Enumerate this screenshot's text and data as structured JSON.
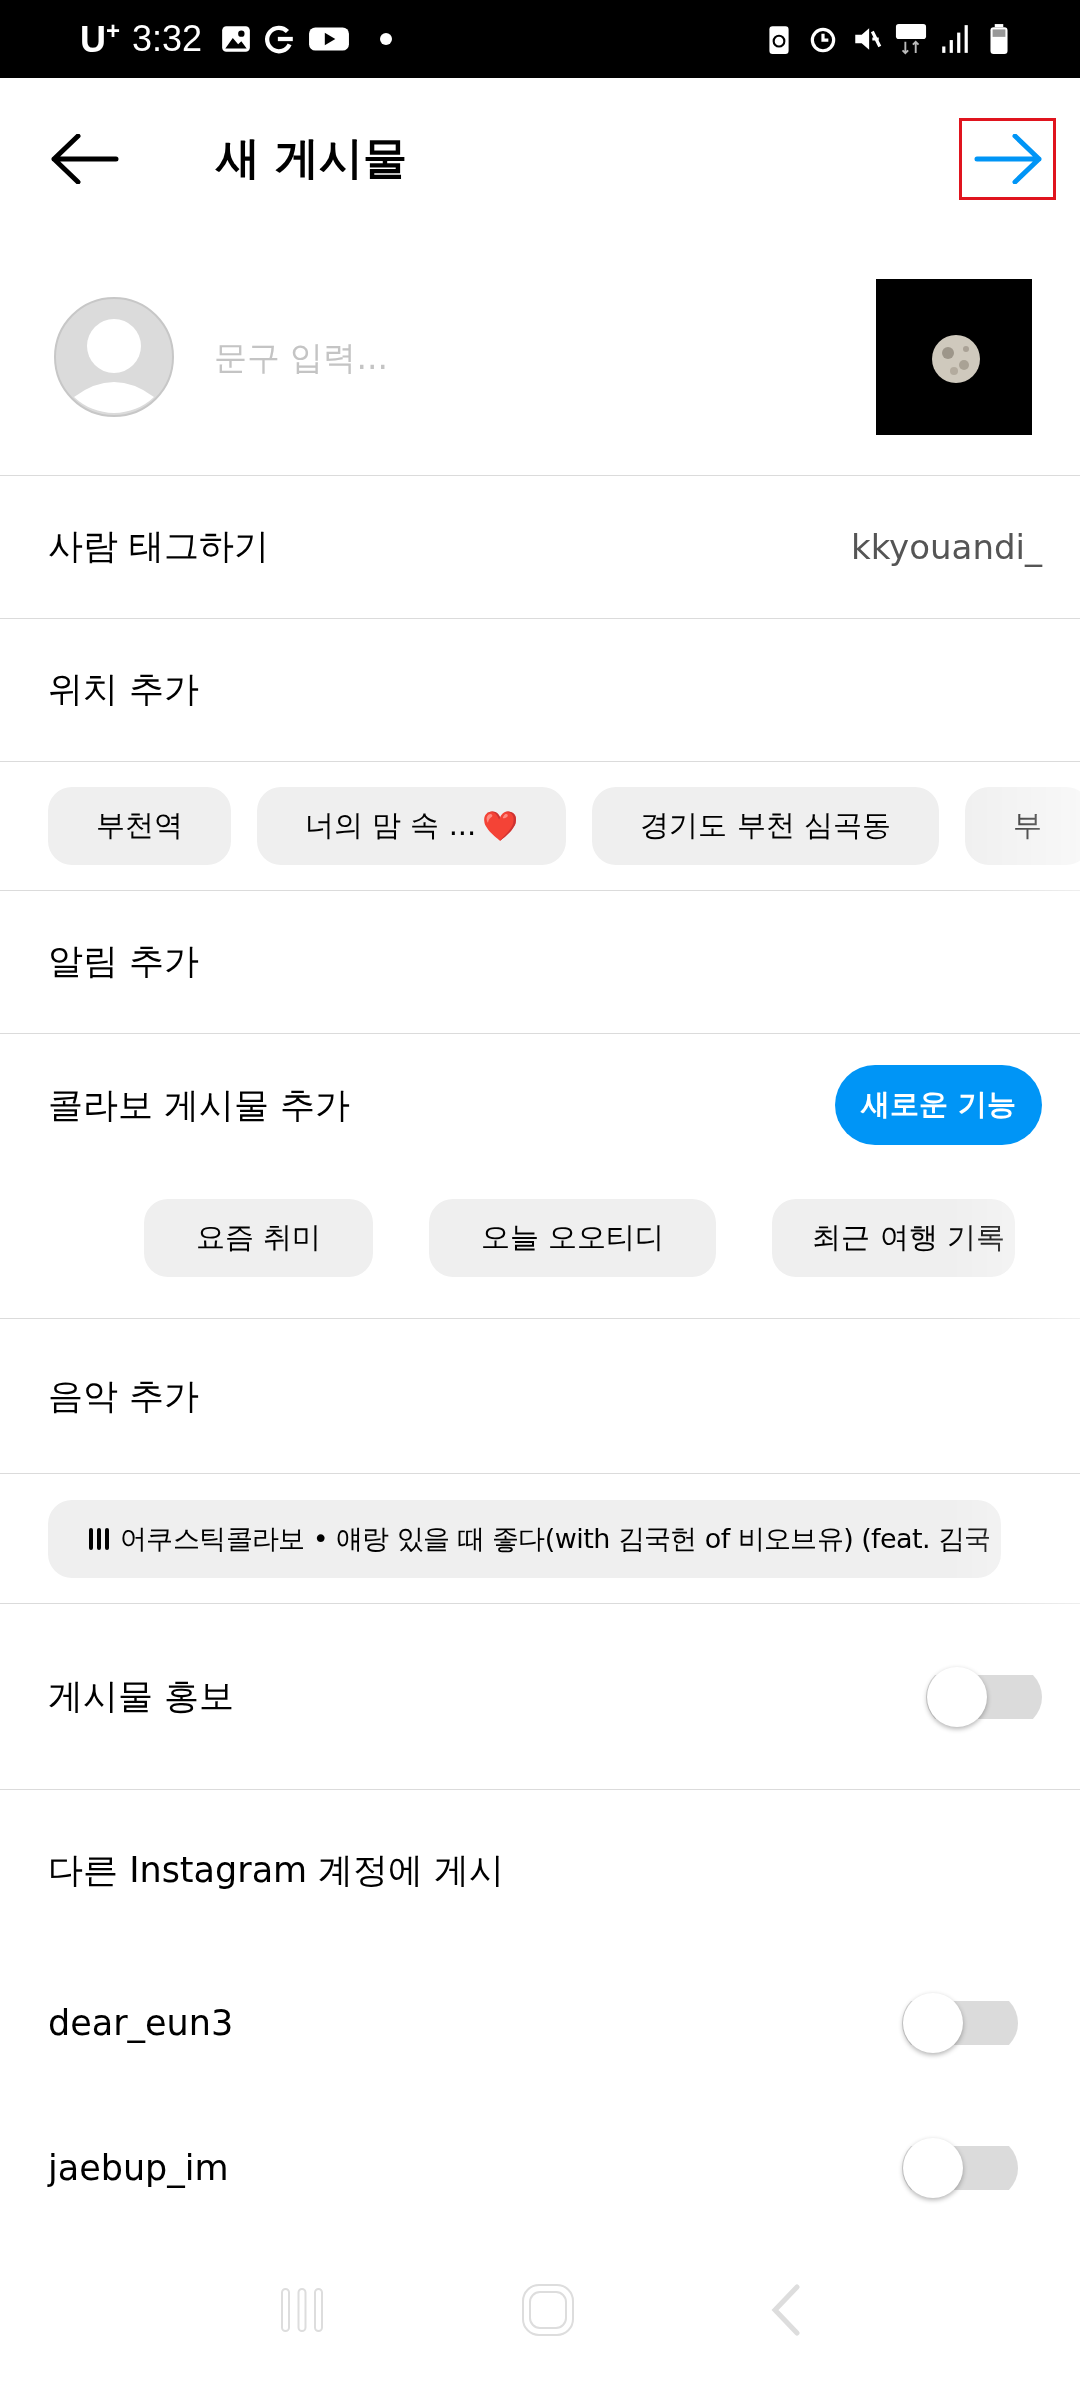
{
  "status_bar": {
    "carrier": "U$^{+}$",
    "time": "3:32"
  },
  "header": {
    "title": "새 게시물"
  },
  "caption": {
    "placeholder": "문구 입력..."
  },
  "tag_people": {
    "label": "사람 태그하기",
    "value": "kkyouandi_"
  },
  "location": {
    "label": "위치 추가",
    "suggestions": [
      {
        "label": "부천역"
      },
      {
        "label": "너의 맘 속 ...",
        "emoji": "❤️"
      },
      {
        "label": "경기도 부천 심곡동"
      },
      {
        "label": "부"
      }
    ]
  },
  "reminder": {
    "label": "알림 추가"
  },
  "collab": {
    "label": "콜라보 게시물 추가",
    "badge": "새로운 기능",
    "suggestions": [
      "요즘 취미",
      "오늘 오오티디",
      "최근 여행 기록"
    ]
  },
  "music": {
    "label": "음악 추가",
    "suggestion": "어쿠스틱콜라보 • 얘랑 있을 때 좋다(with 김국헌 of 비오브유) (feat. 김국"
  },
  "promote": {
    "label": "게시물 홍보",
    "on": false
  },
  "other_accounts": {
    "title": "다른 Instagram 계정에 게시",
    "accounts": [
      {
        "name": "dear_eun3",
        "on": false
      },
      {
        "name": "jaebup_im",
        "on": false
      }
    ]
  }
}
